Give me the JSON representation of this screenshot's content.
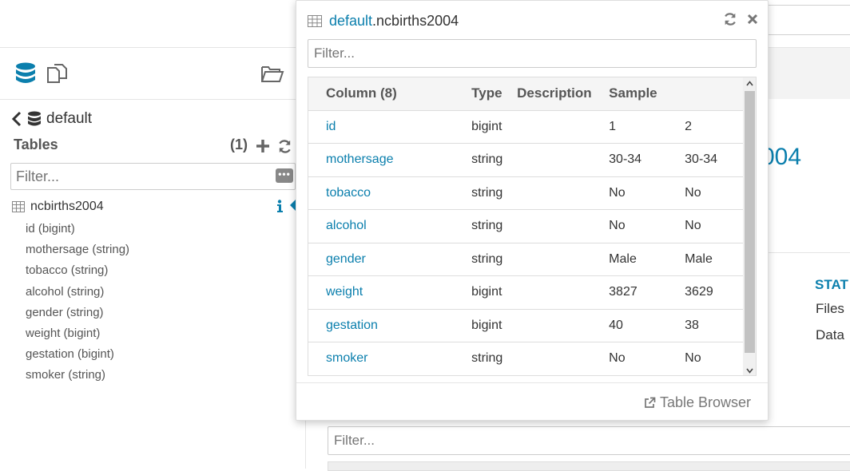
{
  "left_panel": {
    "breadcrumb": {
      "database": "default"
    },
    "tables_header": "Tables",
    "tables_count": "(1)",
    "filter_placeholder": "Filter...",
    "table": {
      "name": "ncbirths2004",
      "columns": [
        "id (bigint)",
        "mothersage (string)",
        "tobacco (string)",
        "alcohol (string)",
        "gender (string)",
        "weight (bigint)",
        "gestation (bigint)",
        "smoker (string)"
      ]
    }
  },
  "popover": {
    "title_db": "default",
    "title_table": ".ncbirths2004",
    "filter_placeholder": "Filter...",
    "headers": {
      "column": "Column (8)",
      "type": "Type",
      "description": "Description",
      "sample": "Sample"
    },
    "rows": [
      {
        "name": "id",
        "type": "bigint",
        "description": "",
        "s1": "1",
        "s2": "2"
      },
      {
        "name": "mothersage",
        "type": "string",
        "description": "",
        "s1": "30-34",
        "s2": "30-34"
      },
      {
        "name": "tobacco",
        "type": "string",
        "description": "",
        "s1": "No",
        "s2": "No"
      },
      {
        "name": "alcohol",
        "type": "string",
        "description": "",
        "s1": "No",
        "s2": "No"
      },
      {
        "name": "gender",
        "type": "string",
        "description": "",
        "s1": "Male",
        "s2": "Male"
      },
      {
        "name": "weight",
        "type": "bigint",
        "description": "",
        "s1": "3827",
        "s2": "3629"
      },
      {
        "name": "gestation",
        "type": "bigint",
        "description": "",
        "s1": "40",
        "s2": "38"
      },
      {
        "name": "smoker",
        "type": "string",
        "description": "",
        "s1": "No",
        "s2": "No"
      }
    ],
    "footer_link": "Table Browser"
  },
  "background": {
    "title_fragment": "004",
    "stats_label": "STAT",
    "files_label": "Files",
    "data_label": "Data",
    "filter_placeholder": "Filter..."
  },
  "colors": {
    "accent": "#0b7fad",
    "text": "#333333",
    "muted": "#555555"
  }
}
